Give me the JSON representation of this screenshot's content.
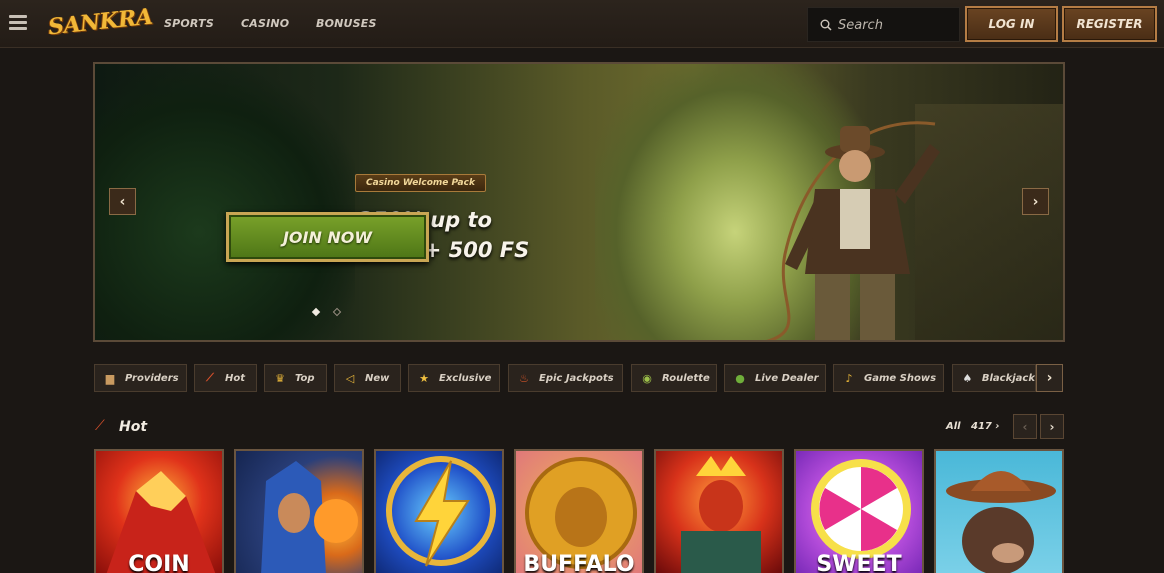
{
  "header": {
    "logo": "SANKRA",
    "nav": [
      "SPORTS",
      "CASINO",
      "BONUSES"
    ],
    "search_placeholder": "Search",
    "login_label": "LOG IN",
    "register_label": "REGISTER"
  },
  "hero": {
    "badge": "Casino Welcome Pack",
    "title_line1": "350% up to",
    "title_line2": "€10,000 + 500 FS",
    "cta_label": "JOIN NOW",
    "prev_icon": "‹",
    "next_icon": "›",
    "slides": 2,
    "active_slide": 1
  },
  "categories": [
    {
      "label": "Providers",
      "icon": "book-icon"
    },
    {
      "label": "Hot",
      "icon": "dynamite-icon"
    },
    {
      "label": "Top",
      "icon": "crown-icon"
    },
    {
      "label": "New",
      "icon": "horn-icon"
    },
    {
      "label": "Exclusive",
      "icon": "star-icon"
    },
    {
      "label": "Epic Jackpots",
      "icon": "fire-icon"
    },
    {
      "label": "Roulette",
      "icon": "roulette-icon"
    },
    {
      "label": "Live Dealer",
      "icon": "chip-icon"
    },
    {
      "label": "Game Shows",
      "icon": "microphone-icon"
    },
    {
      "label": "Blackjack",
      "icon": "cards-icon"
    }
  ],
  "hot_section": {
    "title": "Hot",
    "all_label": "All",
    "count": "417",
    "games": [
      {
        "label": "COIN"
      },
      {
        "label": ""
      },
      {
        "label": ""
      },
      {
        "label": "BUFFALO"
      },
      {
        "label": ""
      },
      {
        "label": "SWEET"
      },
      {
        "label": ""
      }
    ]
  },
  "colors": {
    "accent_gold": "#c9a654",
    "cta_green": "#6a9624",
    "button_brown": "#5a3a1c"
  }
}
